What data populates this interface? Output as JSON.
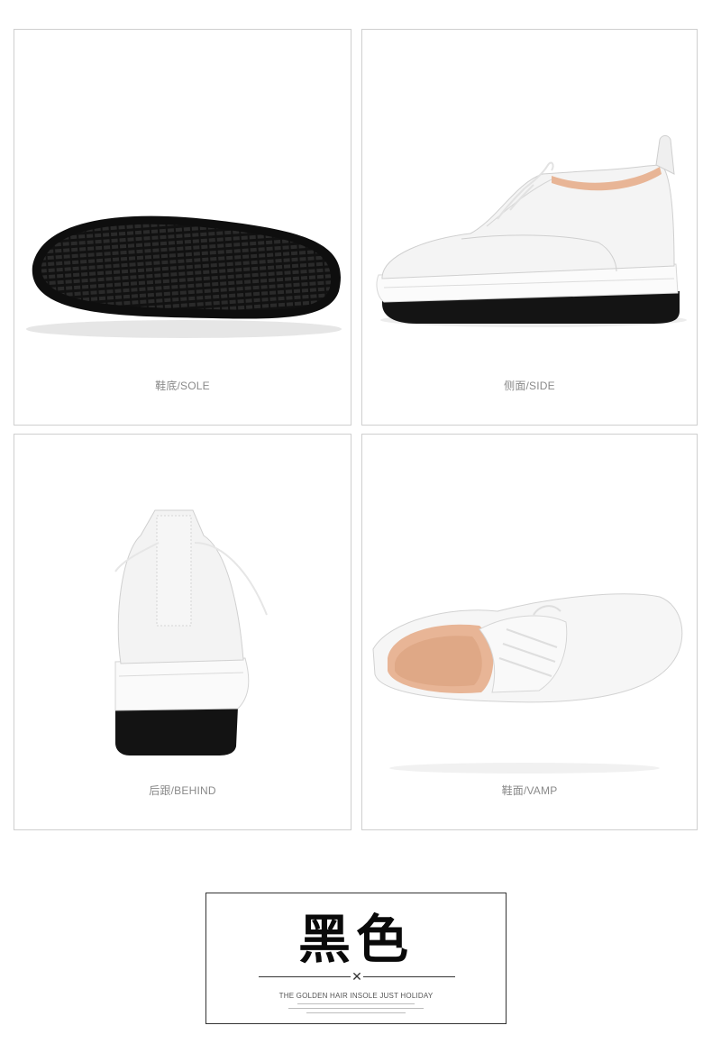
{
  "panels": {
    "sole": {
      "caption": "鞋底/SOLE"
    },
    "side": {
      "caption": "侧面/SIDE"
    },
    "behind": {
      "caption": "后跟/BEHIND"
    },
    "vamp": {
      "caption": "鞋面/VAMP"
    }
  },
  "color_label": {
    "title": "黑色",
    "slogan": "THE GOLDEN HAIR INSOLE JUST HOLIDAY"
  },
  "colors": {
    "shoe_white": "#f2f2f2",
    "sole_black": "#161616",
    "lining_tan": "#e8b596",
    "border": "#cfcfcf"
  }
}
